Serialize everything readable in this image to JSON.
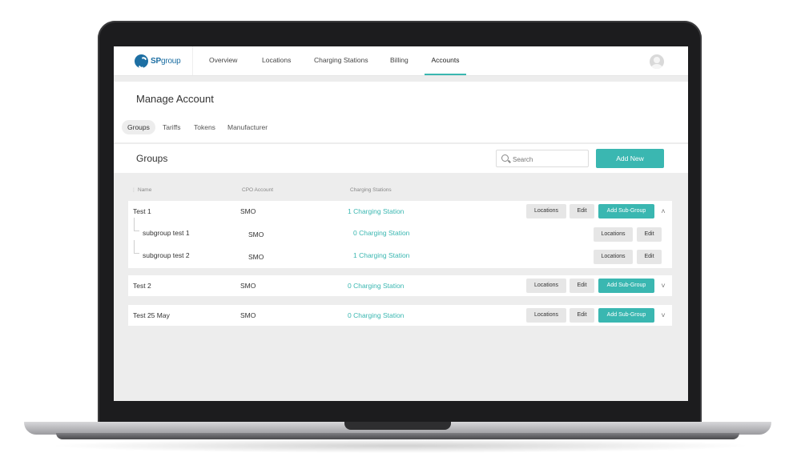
{
  "nav": {
    "logo_text_bold": "SP",
    "logo_text": "group",
    "items": [
      {
        "label": "Overview"
      },
      {
        "label": "Locations"
      },
      {
        "label": "Charging Stations"
      },
      {
        "label": "Billing"
      },
      {
        "label": "Accounts",
        "active": true
      }
    ]
  },
  "page": {
    "title": "Manage Account",
    "subtabs": [
      {
        "label": "Groups",
        "active": true
      },
      {
        "label": "Tariffs"
      },
      {
        "label": "Tokens"
      },
      {
        "label": "Manufacturer"
      }
    ]
  },
  "groups": {
    "title": "Groups",
    "search_placeholder": "Search",
    "add_new_label": "Add New",
    "columns": {
      "name": "Name",
      "cpo": "CPO Account",
      "stations": "Charging Stations"
    },
    "rows": [
      {
        "name": "Test 1",
        "cpo": "SMO",
        "stations": "1 Charging Station",
        "expanded": true,
        "subgroups": [
          {
            "name": "subgroup test 1",
            "cpo": "SMO",
            "stations": "0 Charging Station"
          },
          {
            "name": "subgroup test 2",
            "cpo": "SMO",
            "stations": "1 Charging Station"
          }
        ]
      },
      {
        "name": "Test 2",
        "cpo": "SMO",
        "stations": "0 Charging Station",
        "expanded": false
      },
      {
        "name": "Test 25 May",
        "cpo": "SMO",
        "stations": "0 Charging Station",
        "expanded": false
      }
    ],
    "buttons": {
      "locations": "Locations",
      "edit": "Edit",
      "add_sub_group": "Add Sub-Group"
    }
  },
  "colors": {
    "accent": "#3ab7b1",
    "brand": "#1d6fa3"
  },
  "icons": {
    "search": "search-icon",
    "expand": "chevron-up-icon",
    "collapse": "chevron-down-icon",
    "user": "user-avatar-icon"
  }
}
